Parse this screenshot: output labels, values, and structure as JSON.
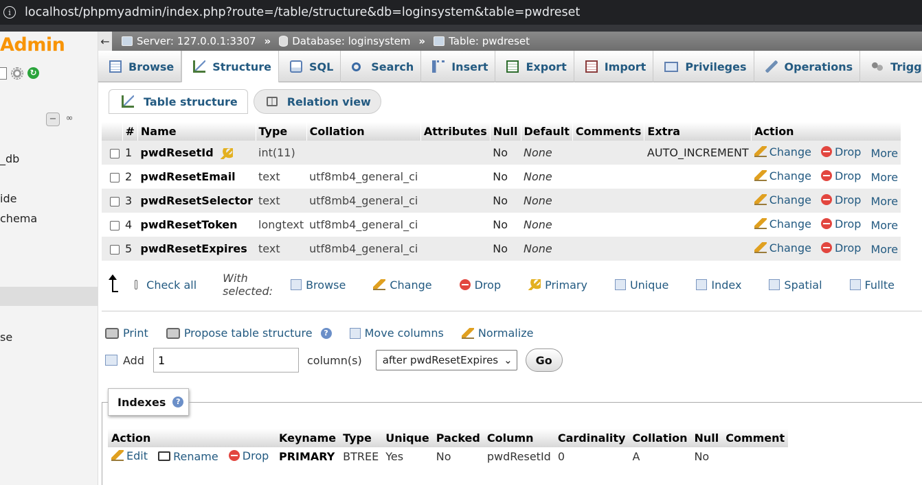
{
  "browser": {
    "url": "localhost/phpmyadmin/index.php?route=/table/structure&db=loginsystem&table=pwdreset"
  },
  "leftnav": {
    "logo": "Admin",
    "items": [
      "_db",
      "ide",
      "chema",
      "se"
    ]
  },
  "breadcrumb": {
    "back": "←",
    "server": "Server: 127.0.0.1:3307",
    "database": "Database: loginsystem",
    "table": "Table: pwdreset",
    "sep": "»"
  },
  "tabs": [
    {
      "label": "Browse",
      "icon": "browse-icon"
    },
    {
      "label": "Structure",
      "icon": "structure-icon"
    },
    {
      "label": "SQL",
      "icon": "sql-icon"
    },
    {
      "label": "Search",
      "icon": "search-icon"
    },
    {
      "label": "Insert",
      "icon": "insert-icon"
    },
    {
      "label": "Export",
      "icon": "export-icon"
    },
    {
      "label": "Import",
      "icon": "import-icon"
    },
    {
      "label": "Privileges",
      "icon": "privileges-icon"
    },
    {
      "label": "Operations",
      "icon": "operations-icon"
    },
    {
      "label": "Triggers",
      "icon": "triggers-icon"
    }
  ],
  "subtabs": {
    "table_structure": "Table structure",
    "relation_view": "Relation view"
  },
  "structure": {
    "headers": [
      "#",
      "Name",
      "Type",
      "Collation",
      "Attributes",
      "Null",
      "Default",
      "Comments",
      "Extra",
      "Action"
    ],
    "rows": [
      {
        "num": "1",
        "name": "pwdResetId",
        "type": "int(11)",
        "collation": "",
        "attributes": "",
        "null": "No",
        "default": "None",
        "comments": "",
        "extra": "AUTO_INCREMENT"
      },
      {
        "num": "2",
        "name": "pwdResetEmail",
        "type": "text",
        "collation": "utf8mb4_general_ci",
        "attributes": "",
        "null": "No",
        "default": "None",
        "comments": "",
        "extra": ""
      },
      {
        "num": "3",
        "name": "pwdResetSelector",
        "type": "text",
        "collation": "utf8mb4_general_ci",
        "attributes": "",
        "null": "No",
        "default": "None",
        "comments": "",
        "extra": ""
      },
      {
        "num": "4",
        "name": "pwdResetToken",
        "type": "longtext",
        "collation": "utf8mb4_general_ci",
        "attributes": "",
        "null": "No",
        "default": "None",
        "comments": "",
        "extra": ""
      },
      {
        "num": "5",
        "name": "pwdResetExpires",
        "type": "text",
        "collation": "utf8mb4_general_ci",
        "attributes": "",
        "null": "No",
        "default": "None",
        "comments": "",
        "extra": ""
      }
    ],
    "actions": {
      "change": "Change",
      "drop": "Drop",
      "more": "More"
    }
  },
  "with_selected": {
    "check_all": "Check all",
    "label": "With selected:",
    "browse": "Browse",
    "change": "Change",
    "drop": "Drop",
    "primary": "Primary",
    "unique": "Unique",
    "index": "Index",
    "spatial": "Spatial",
    "fulltext": "Fullte"
  },
  "tools": {
    "print": "Print",
    "propose": "Propose table structure",
    "move_columns": "Move columns",
    "normalize": "Normalize"
  },
  "add": {
    "label": "Add",
    "value": "1",
    "columns_label": "column(s)",
    "position": "after pwdResetExpires",
    "go": "Go"
  },
  "indexes": {
    "legend": "Indexes",
    "headers": [
      "Action",
      "Keyname",
      "Type",
      "Unique",
      "Packed",
      "Column",
      "Cardinality",
      "Collation",
      "Null",
      "Comment"
    ],
    "actions": {
      "edit": "Edit",
      "rename": "Rename",
      "drop": "Drop"
    },
    "row": {
      "keyname": "PRIMARY",
      "type": "BTREE",
      "unique": "Yes",
      "packed": "No",
      "column": "pwdResetId",
      "cardinality": "0",
      "collation": "A",
      "null": "No",
      "comment": ""
    }
  }
}
